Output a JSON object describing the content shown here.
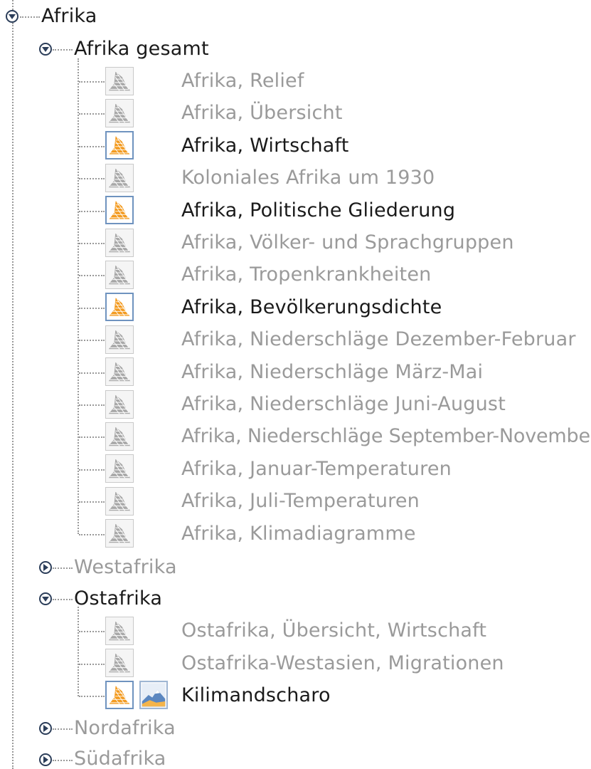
{
  "tree": {
    "root": {
      "label": "Afrika",
      "expanded": true
    },
    "groups": [
      {
        "label": "Afrika gesamt",
        "expanded": true,
        "active": true,
        "items": [
          {
            "label": "Afrika, Relief",
            "active": false,
            "icon": "map-gray-icon"
          },
          {
            "label": "Afrika, Übersicht",
            "active": false,
            "icon": "map-gray-icon"
          },
          {
            "label": "Afrika, Wirtschaft",
            "active": true,
            "icon": "map-orange-icon"
          },
          {
            "label": "Koloniales Afrika um 1930",
            "active": false,
            "icon": "map-gray-icon"
          },
          {
            "label": "Afrika, Politische Gliederung",
            "active": true,
            "icon": "map-orange-icon"
          },
          {
            "label": "Afrika, Völker- und Sprachgruppen",
            "active": false,
            "icon": "map-gray-icon"
          },
          {
            "label": "Afrika, Tropenkrankheiten",
            "active": false,
            "icon": "map-gray-icon"
          },
          {
            "label": "Afrika, Bevölkerungsdichte",
            "active": true,
            "icon": "map-orange-icon"
          },
          {
            "label": "Afrika, Niederschläge Dezember-Februar",
            "active": false,
            "icon": "map-gray-icon"
          },
          {
            "label": "Afrika, Niederschläge März-Mai",
            "active": false,
            "icon": "map-gray-icon"
          },
          {
            "label": "Afrika, Niederschläge Juni-August",
            "active": false,
            "icon": "map-gray-icon"
          },
          {
            "label": "Afrika, Niederschläge September-November",
            "active": false,
            "icon": "map-gray-icon"
          },
          {
            "label": "Afrika, Januar-Temperaturen",
            "active": false,
            "icon": "map-gray-icon"
          },
          {
            "label": "Afrika, Juli-Temperaturen",
            "active": false,
            "icon": "map-gray-icon"
          },
          {
            "label": "Afrika, Klimadiagramme",
            "active": false,
            "icon": "map-gray-icon"
          }
        ]
      },
      {
        "label": "Westafrika",
        "expanded": false,
        "active": false,
        "items": []
      },
      {
        "label": "Ostafrika",
        "expanded": true,
        "active": true,
        "items": [
          {
            "label": "Ostafrika, Übersicht, Wirtschaft",
            "active": false,
            "icon": "map-gray-icon"
          },
          {
            "label": "Ostafrika-Westasien, Migrationen",
            "active": false,
            "icon": "map-gray-icon"
          },
          {
            "label": "Kilimandscharo",
            "active": true,
            "icon": "map-orange-icon",
            "extra_icon": "photo-panorama-icon"
          }
        ]
      },
      {
        "label": "Nordafrika",
        "expanded": false,
        "active": false,
        "items": []
      },
      {
        "label": "Südafrika",
        "expanded": false,
        "active": false,
        "items": []
      }
    ]
  },
  "colors": {
    "active_text": "#1a1a1a",
    "inactive_text": "#9a9a9a",
    "connector": "#9a9a9a",
    "toggle": "#2c3e5a",
    "map_orange": "#f39a1e",
    "map_gray": "#a8a8a8",
    "icon_frame_active": "#6f93bf"
  }
}
